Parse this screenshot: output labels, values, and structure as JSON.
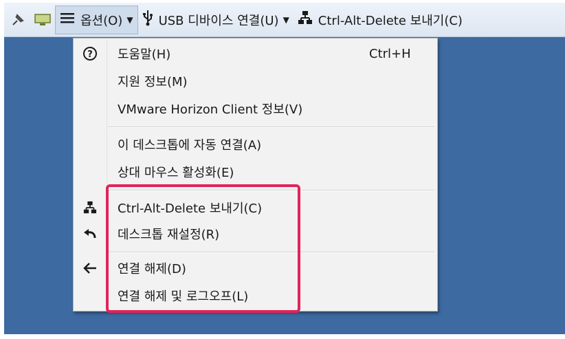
{
  "toolbar": {
    "options_label": "옵션(O)",
    "usb_label": "USB 디바이스 연결(U)",
    "cad_label": "Ctrl-Alt-Delete 보내기(C)"
  },
  "menu": {
    "group1": [
      {
        "label": "도움말(H)",
        "shortcut": "Ctrl+H",
        "icon": "help-icon"
      },
      {
        "label": "지원 정보(M)"
      },
      {
        "label": "VMware Horizon Client 정보(V)"
      }
    ],
    "group2": [
      {
        "label": "이 데스크톱에 자동 연결(A)"
      },
      {
        "label": "상대 마우스 활성화(E)"
      }
    ],
    "group3": [
      {
        "label": "Ctrl-Alt-Delete 보내기(C)",
        "icon": "network-icon"
      },
      {
        "label": "데스크톱 재설정(R)",
        "icon": "undo-arrow-icon"
      }
    ],
    "group4": [
      {
        "label": "연결 해제(D)",
        "icon": "left-arrow-icon"
      },
      {
        "label": "연결 해제 및 로그오프(L)"
      }
    ]
  },
  "colors": {
    "desktop": "#3d6aa0",
    "highlight": "#e1245b",
    "menu_bg": "#f2f2f2"
  }
}
